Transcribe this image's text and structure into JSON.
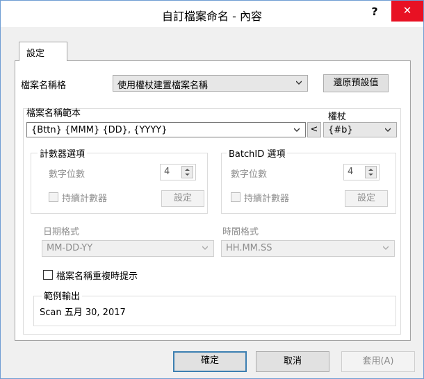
{
  "window": {
    "title": "自訂檔案命名 - 內容",
    "help_label": "?",
    "close_label": "✕"
  },
  "tab": {
    "label": "設定"
  },
  "filename_format": {
    "label": "檔案名稱格",
    "value": "使用權杖建置檔案名稱",
    "reset_button": "還原預設值"
  },
  "template": {
    "label": "檔案名稱範本",
    "value": "{Bttn} {MMM} {DD}, {YYYY}",
    "insert_button": "<"
  },
  "token": {
    "label": "權杖",
    "value": "{#b}"
  },
  "counter": {
    "title": "計數器選項",
    "digits_label": "數字位數",
    "digits_value": "4",
    "persist_label": "持續計數器",
    "settings_button": "設定"
  },
  "batchid": {
    "title": "BatchID 選項",
    "digits_label": "數字位數",
    "digits_value": "4",
    "persist_label": "持續計數器",
    "settings_button": "設定"
  },
  "date_format": {
    "label": "日期格式",
    "value": "MM-DD-YY"
  },
  "time_format": {
    "label": "時間格式",
    "value": "HH.MM.SS"
  },
  "duplicate_prompt": {
    "label": "檔案名稱重複時提示"
  },
  "sample": {
    "title": "範例輸出",
    "value": "Scan 五月 30, 2017"
  },
  "footer": {
    "ok": "確定",
    "cancel": "取消",
    "apply": "套用(A)"
  }
}
